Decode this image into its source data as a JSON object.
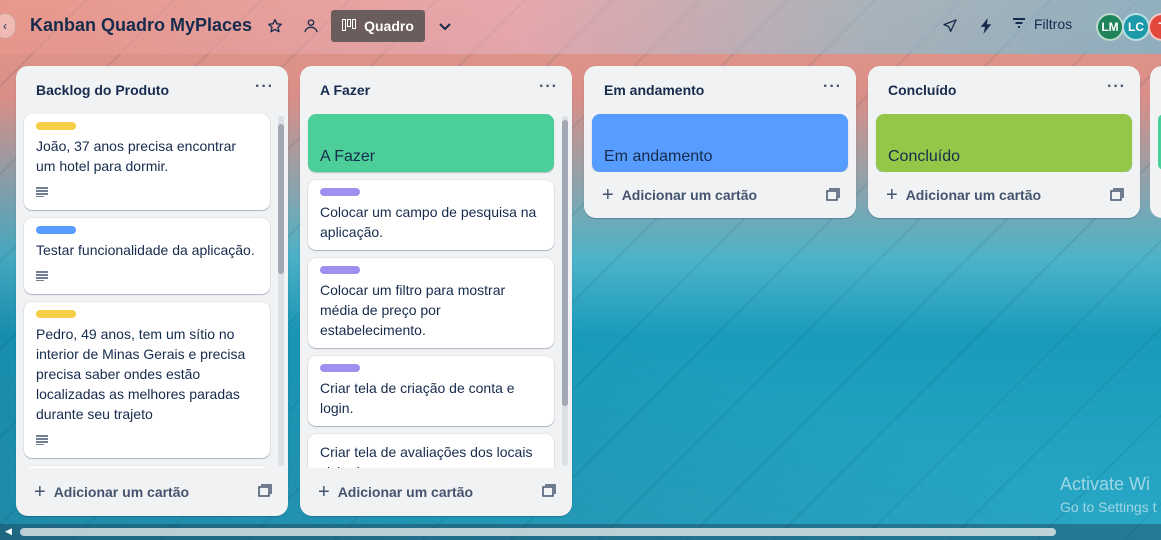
{
  "board": {
    "title": "Kanban Quadro MyPlaces",
    "view_label": "Quadro",
    "filters_label": "Filtros",
    "members": [
      {
        "initials": "LM",
        "color": "#1f845a"
      },
      {
        "initials": "LC",
        "color": "#1d9aaa"
      },
      {
        "initials": "T",
        "color": "#e2483d"
      }
    ]
  },
  "icons": {
    "collapse": "chevron-left-icon",
    "star": "star-icon",
    "visibility": "people-icon",
    "board_view": "board-icon",
    "view_menu": "chevron-down-icon",
    "power_ups": "rocket-icon",
    "automation": "lightning-icon",
    "filter": "filter-icon",
    "list_menu": "more-icon",
    "add_card": "plus-icon",
    "template": "template-icon",
    "description": "description-icon"
  },
  "add_card_label": "Adicionar um cartão",
  "lists": [
    {
      "title": "Backlog do Produto",
      "cards": [
        {
          "label_color": "#f5cd47",
          "text": "João, 37 anos precisa encontrar um hotel para dormir.",
          "has_description": true
        },
        {
          "label_color": "#579dff",
          "text": "Testar funcionalidade da aplicação.",
          "has_description": true
        },
        {
          "label_color": "#f5cd47",
          "text": "Pedro, 49 anos, tem um sítio no interior de Minas Gerais e precisa precisa saber ondes estão localizadas as melhores paradas durante seu trajeto",
          "has_description": true
        }
      ]
    },
    {
      "title": "A Fazer",
      "cover": {
        "text": "A Fazer",
        "color": "#4bce97"
      },
      "cards": [
        {
          "label_color": "#9f8fef",
          "text": "Colocar um campo de pesquisa na aplicação."
        },
        {
          "label_color": "#9f8fef",
          "text": "Colocar um filtro para mostrar média de preço por estabelecimento."
        },
        {
          "label_color": "#9f8fef",
          "text": "Criar tela de criação de conta e login."
        },
        {
          "text": "Criar tela de avaliações dos locais visitados."
        }
      ]
    },
    {
      "title": "Em andamento",
      "cover": {
        "text": "Em andamento",
        "color": "#579dff"
      }
    },
    {
      "title": "Concluído",
      "cover": {
        "text": "Concluído",
        "color": "#94c748"
      }
    }
  ],
  "watermark": {
    "line1": "Activate Wi",
    "line2": "Go to Settings t"
  }
}
